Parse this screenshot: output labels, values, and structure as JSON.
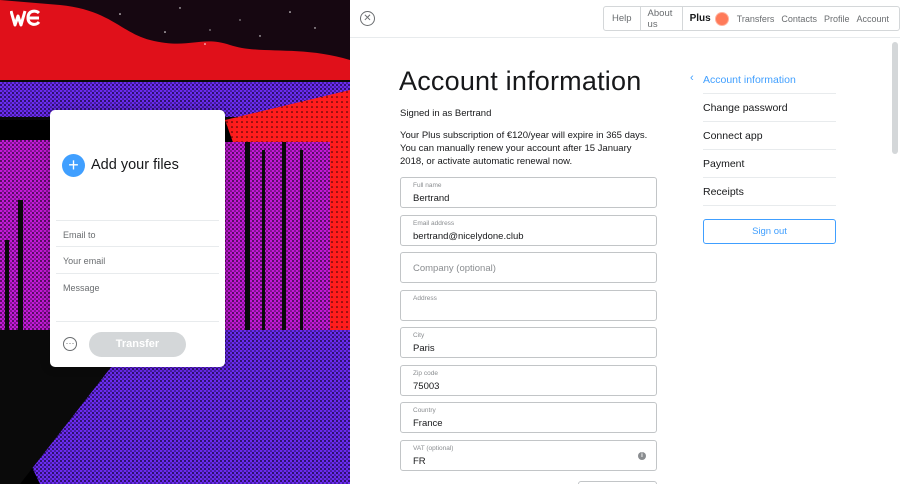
{
  "brand": {
    "accent": "#409fff",
    "logo_icon": "wetransfer-logo-icon"
  },
  "upload_card": {
    "add_label": "Add your files",
    "email_to_placeholder": "Email to",
    "your_email_placeholder": "Your email",
    "message_placeholder": "Message",
    "transfer_label": "Transfer",
    "options_icon": "more-options-icon"
  },
  "topnav": {
    "help": "Help",
    "about": "About us",
    "plus": "Plus",
    "transfers": "Transfers",
    "contacts": "Contacts",
    "profile": "Profile",
    "account": "Account"
  },
  "main": {
    "title": "Account information",
    "signed_in": "Signed in as Bertrand",
    "subscription": "Your Plus subscription of €120/year will expire in 365 days. You can manually renew your account after 15 January 2018, or activate automatic renewal now.",
    "fields": [
      {
        "label": "Full name",
        "value": "Bertrand"
      },
      {
        "label": "Email address",
        "value": "bertrand@nicelydone.club"
      },
      {
        "label": "",
        "placeholder": "Company (optional)"
      },
      {
        "label": "Address",
        "value": ""
      },
      {
        "label": "City",
        "value": "Paris"
      },
      {
        "label": "Zip code",
        "value": "75003"
      },
      {
        "label": "Country",
        "value": "France"
      },
      {
        "label": "VAT (optional)",
        "value": "FR"
      }
    ]
  },
  "side_menu": {
    "items": [
      "Account information",
      "Change password",
      "Connect app",
      "Payment",
      "Receipts"
    ],
    "sign_out": "Sign out"
  }
}
